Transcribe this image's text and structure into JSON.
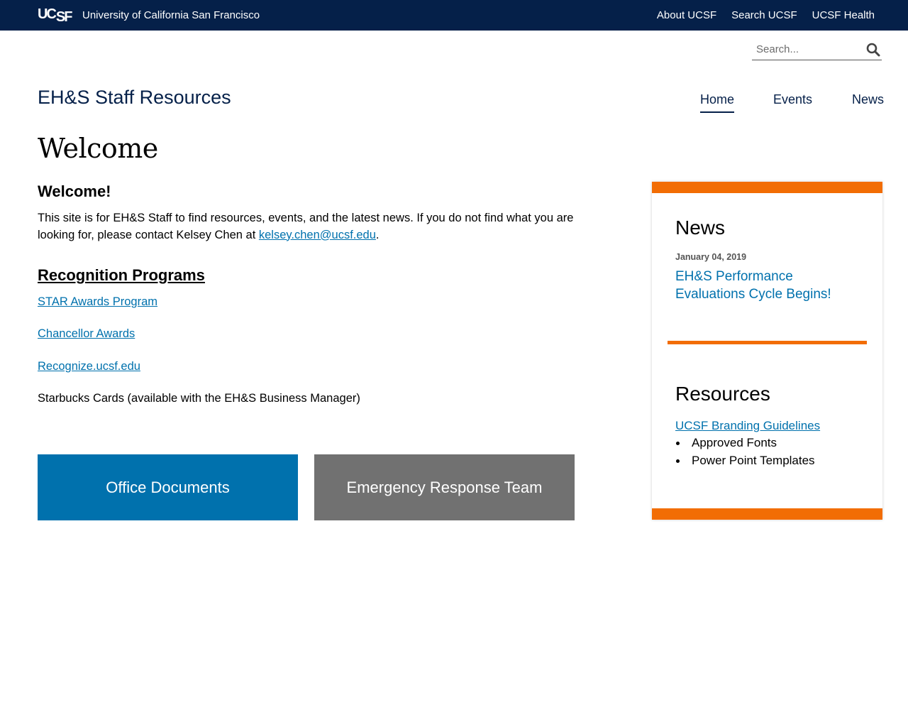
{
  "header": {
    "logo_uc": "UC",
    "logo_sf": "SF",
    "university_name": "University of California San Francisco",
    "links": [
      "About UCSF",
      "Search UCSF",
      "UCSF Health"
    ]
  },
  "search": {
    "placeholder": "Search..."
  },
  "site": {
    "title": "EH&S Staff Resources"
  },
  "nav": {
    "items": [
      "Home",
      "Events",
      "News"
    ],
    "active": "Home"
  },
  "main": {
    "page_title": "Welcome",
    "welcome_heading": "Welcome!",
    "intro_text": "This site is for EH&S Staff to find resources, events, and the latest news. If you do not find what you are looking for, please contact Kelsey Chen at ",
    "intro_email": "kelsey.chen@ucsf.edu",
    "intro_end": ".",
    "recognition_heading": "Recognition Programs",
    "program_links": [
      "STAR Awards Program",
      "Chancellor Awards",
      "Recognize.ucsf.edu"
    ],
    "starbucks_text": "Starbucks Cards (available with the EH&S Business Manager)",
    "buttons": [
      "Office Documents",
      "Emergency Response Team"
    ]
  },
  "sidebar": {
    "news_heading": "News",
    "news_date": "January 04, 2019",
    "news_title": "EH&S Performance Evaluations Cycle Begins!",
    "resources_heading": "Resources",
    "resources_link": "UCSF Branding Guidelines",
    "resources_items": [
      "Approved Fonts",
      "Power Point Templates"
    ]
  },
  "colors": {
    "header_navy": "#052049",
    "link_blue": "#0071ad",
    "accent_orange": "#f26d04",
    "button_gray": "#717171"
  },
  "icons": {
    "search": "search-icon"
  }
}
